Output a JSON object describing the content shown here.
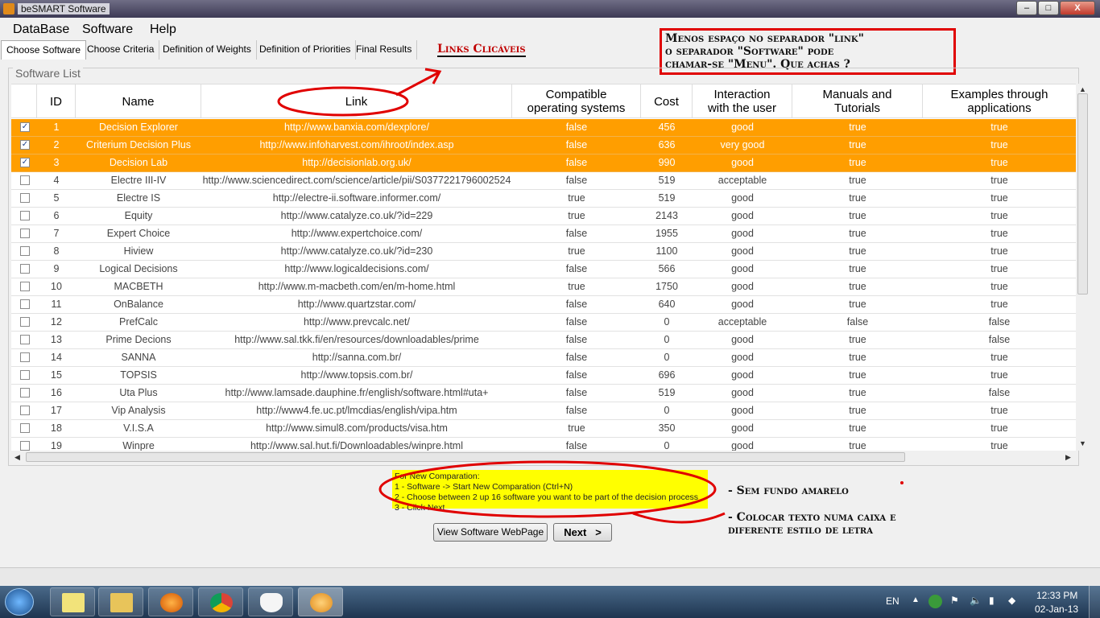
{
  "window": {
    "title": "beSMART Software",
    "controls": [
      "–",
      "□",
      "X"
    ]
  },
  "menu": [
    "DataBase",
    "Software",
    "Help"
  ],
  "tabs": [
    "Choose Software",
    "Choose Criteria",
    "Definition of Weights",
    "Definition of Priorities",
    "Final Results"
  ],
  "annotations": {
    "links": "Links Clicáveis",
    "box_line1": "Menos espaço no separador \"link\"",
    "box_line2": "o separador \"Software\" pode",
    "box_line3": "chamar-se \"Menu\". Que achas ?",
    "note1": "- Sem fundo amarelo",
    "note2_line1": "- Colocar texto numa caixa e",
    "note2_line2": "diferente estilo de letra"
  },
  "group_label": "Software List",
  "columns": [
    "ID",
    "Name",
    "Link",
    "Compatible operating systems",
    "Cost",
    "Interaction with the user",
    "Manuals and Tutorials",
    "Examples through applications"
  ],
  "columns_display": {
    "compat_1": "Compatible",
    "compat_2": "operating systems",
    "inter_1": "Interaction",
    "inter_2": "with the user",
    "man_1": "Manuals and",
    "man_2": "Tutorials",
    "ex_1": "Examples through",
    "ex_2": "applications"
  },
  "rows": [
    {
      "checked": true,
      "id": "1",
      "name": "Decision Explorer",
      "link": "http://www.banxia.com/dexplore/",
      "os": "false",
      "cost": "456",
      "interaction": "good",
      "manuals": "true",
      "examples": "true"
    },
    {
      "checked": true,
      "id": "2",
      "name": "Criterium Decision Plus",
      "link": "http://www.infoharvest.com/ihroot/index.asp",
      "os": "false",
      "cost": "636",
      "interaction": "very good",
      "manuals": "true",
      "examples": "true"
    },
    {
      "checked": true,
      "id": "3",
      "name": "Decision Lab",
      "link": "http://decisionlab.org.uk/",
      "os": "false",
      "cost": "990",
      "interaction": "good",
      "manuals": "true",
      "examples": "true"
    },
    {
      "checked": false,
      "id": "4",
      "name": "Electre III-IV",
      "link": "http://www.sciencedirect.com/science/article/pii/S0377221796002524",
      "os": "false",
      "cost": "519",
      "interaction": "acceptable",
      "manuals": "true",
      "examples": "true"
    },
    {
      "checked": false,
      "id": "5",
      "name": "Electre IS",
      "link": "http://electre-ii.software.informer.com/",
      "os": "true",
      "cost": "519",
      "interaction": "good",
      "manuals": "true",
      "examples": "true"
    },
    {
      "checked": false,
      "id": "6",
      "name": "Equity",
      "link": "http://www.catalyze.co.uk/?id=229",
      "os": "true",
      "cost": "2143",
      "interaction": "good",
      "manuals": "true",
      "examples": "true"
    },
    {
      "checked": false,
      "id": "7",
      "name": "Expert Choice",
      "link": "http://www.expertchoice.com/",
      "os": "false",
      "cost": "1955",
      "interaction": "good",
      "manuals": "true",
      "examples": "true"
    },
    {
      "checked": false,
      "id": "8",
      "name": "Hiview",
      "link": "http://www.catalyze.co.uk/?id=230",
      "os": "true",
      "cost": "1100",
      "interaction": "good",
      "manuals": "true",
      "examples": "true"
    },
    {
      "checked": false,
      "id": "9",
      "name": "Logical Decisions",
      "link": "http://www.logicaldecisions.com/",
      "os": "false",
      "cost": "566",
      "interaction": "good",
      "manuals": "true",
      "examples": "true"
    },
    {
      "checked": false,
      "id": "10",
      "name": "MACBETH",
      "link": "http://www.m-macbeth.com/en/m-home.html",
      "os": "true",
      "cost": "1750",
      "interaction": "good",
      "manuals": "true",
      "examples": "true"
    },
    {
      "checked": false,
      "id": "11",
      "name": "OnBalance",
      "link": "http://www.quartzstar.com/",
      "os": "false",
      "cost": "640",
      "interaction": "good",
      "manuals": "true",
      "examples": "true"
    },
    {
      "checked": false,
      "id": "12",
      "name": "PrefCalc",
      "link": "http://www.prevcalc.net/",
      "os": "false",
      "cost": "0",
      "interaction": "acceptable",
      "manuals": "false",
      "examples": "false"
    },
    {
      "checked": false,
      "id": "13",
      "name": "Prime Decions",
      "link": "http://www.sal.tkk.fi/en/resources/downloadables/prime",
      "os": "false",
      "cost": "0",
      "interaction": "good",
      "manuals": "true",
      "examples": "false"
    },
    {
      "checked": false,
      "id": "14",
      "name": "SANNA",
      "link": "http://sanna.com.br/",
      "os": "false",
      "cost": "0",
      "interaction": "good",
      "manuals": "true",
      "examples": "true"
    },
    {
      "checked": false,
      "id": "15",
      "name": "TOPSIS",
      "link": "http://www.topsis.com.br/",
      "os": "false",
      "cost": "696",
      "interaction": "good",
      "manuals": "true",
      "examples": "true"
    },
    {
      "checked": false,
      "id": "16",
      "name": "Uta Plus",
      "link": "http://www.lamsade.dauphine.fr/english/software.html#uta+",
      "os": "false",
      "cost": "519",
      "interaction": "good",
      "manuals": "true",
      "examples": "false"
    },
    {
      "checked": false,
      "id": "17",
      "name": "Vip Analysis",
      "link": "http://www4.fe.uc.pt/lmcdias/english/vipa.htm",
      "os": "false",
      "cost": "0",
      "interaction": "good",
      "manuals": "true",
      "examples": "true"
    },
    {
      "checked": false,
      "id": "18",
      "name": "V.I.S.A",
      "link": "http://www.simul8.com/products/visa.htm",
      "os": "true",
      "cost": "350",
      "interaction": "good",
      "manuals": "true",
      "examples": "true"
    },
    {
      "checked": false,
      "id": "19",
      "name": "Winpre",
      "link": "http://www.sal.hut.fi/Downloadables/winpre.html",
      "os": "false",
      "cost": "0",
      "interaction": "good",
      "manuals": "true",
      "examples": "true"
    }
  ],
  "help": {
    "line1": "For New Comparation:",
    "line2": "1 - Software -> Start New Comparation (Ctrl+N)",
    "line3": "2 - Choose between 2 up 16 software you want to be part of the decision process",
    "line4": "3 - Click Next"
  },
  "buttons": {
    "view": "View Software WebPage",
    "next": "Next   >"
  },
  "tray": {
    "lang": "EN",
    "time": "12:33 PM",
    "date": "02-Jan-13"
  },
  "taskbar_icons": [
    "windows-start-icon",
    "sticky-notes-icon",
    "explorer-icon",
    "firefox-icon",
    "chrome-icon",
    "fox-app-icon",
    "besmart-icon"
  ],
  "colors": {
    "selected_row": "#ff9e00",
    "help_bg": "#ffff00",
    "annotation_red": "#e00000"
  }
}
